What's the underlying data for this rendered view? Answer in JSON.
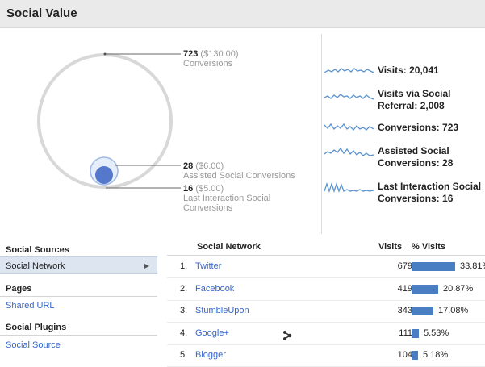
{
  "header": {
    "title": "Social Value"
  },
  "conversions": {
    "total": {
      "count": "723",
      "value": "($130.00)",
      "label": "Conversions"
    },
    "assisted": {
      "count": "28",
      "value": "($6.00)",
      "label": "Assisted Social Conversions"
    },
    "last_interaction": {
      "count": "16",
      "value": "($5.00)",
      "label_line1": "Last Interaction Social",
      "label_line2": "Conversions"
    }
  },
  "metrics": [
    {
      "line1": "Visits: 20,041",
      "line2": ""
    },
    {
      "line1": "Visits via Social",
      "line2": "Referral: 2,008"
    },
    {
      "line1": "Conversions: 723",
      "line2": ""
    },
    {
      "line1": "Assisted Social",
      "line2": "Conversions: 28"
    },
    {
      "line1": "Last Interaction Social",
      "line2": "Conversions: 16"
    }
  ],
  "sidebar": {
    "sources_heading": "Social Sources",
    "social_network": "Social Network",
    "pages_heading": "Pages",
    "shared_url": "Shared URL",
    "plugins_heading": "Social Plugins",
    "social_source": "Social Source"
  },
  "table": {
    "headers": {
      "network": "Social Network",
      "visits": "Visits",
      "pct": "% Visits"
    },
    "rows": [
      {
        "rank": "1.",
        "name": "Twitter",
        "visits": "679",
        "pct": "33.81%",
        "share": 0.3381
      },
      {
        "rank": "2.",
        "name": "Facebook",
        "visits": "419",
        "pct": "20.87%",
        "share": 0.2087
      },
      {
        "rank": "3.",
        "name": "StumbleUpon",
        "visits": "343",
        "pct": "17.08%",
        "share": 0.1708
      },
      {
        "rank": "4.",
        "name": "Google+",
        "visits": "111",
        "pct": "5.53%",
        "share": 0.0553
      },
      {
        "rank": "5.",
        "name": "Blogger",
        "visits": "104",
        "pct": "5.18%",
        "share": 0.0518
      }
    ]
  },
  "colors": {
    "bar": "#4a7ec3",
    "link": "#3366cc",
    "bubble_outer": "#d8d8d8",
    "bubble_inner": "#5577cc"
  }
}
